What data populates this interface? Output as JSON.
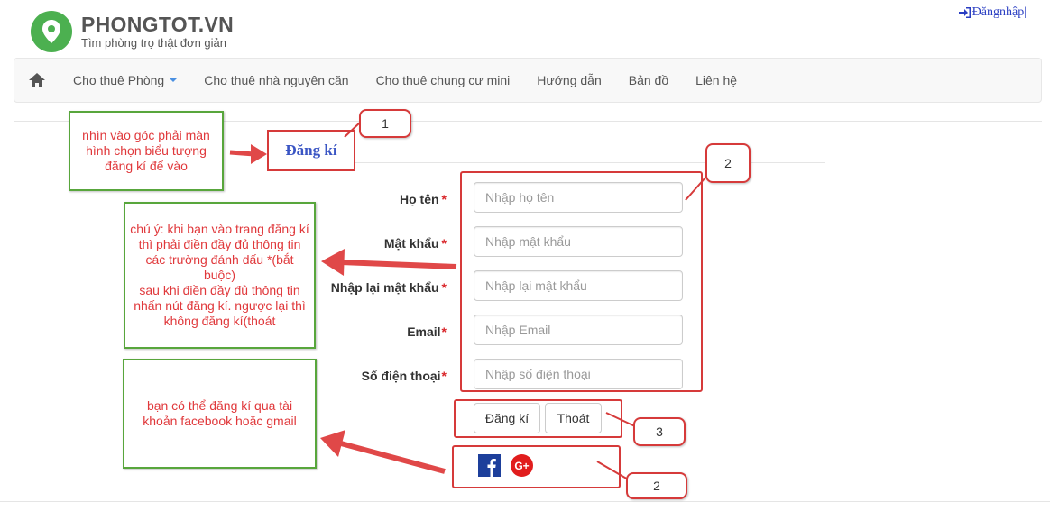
{
  "header": {
    "logo_title": "PHONGTOT.VN",
    "logo_subtitle": "Tìm phòng trọ thật đơn giản",
    "login_label": "Đăngnhập|"
  },
  "nav": {
    "items": [
      {
        "label": "Cho thuê Phòng"
      },
      {
        "label": "Cho thuê nhà nguyên căn"
      },
      {
        "label": "Cho thuê chung cư mini"
      },
      {
        "label": "Hướng dẫn"
      },
      {
        "label": "Bản đồ"
      },
      {
        "label": "Liên hệ"
      }
    ]
  },
  "form": {
    "title": "Đăng kí",
    "required_mark": "*",
    "fields": [
      {
        "label": "Họ tên",
        "placeholder": "Nhập họ tên"
      },
      {
        "label": "Mật khẩu",
        "placeholder": "Nhập mật khẩu"
      },
      {
        "label": "Nhập lại mật khẩu",
        "placeholder": "Nhập lại mật khẩu"
      },
      {
        "label": "Email",
        "placeholder": "Nhập Email"
      },
      {
        "label": "Số điện thoại",
        "placeholder": "Nhập số điện thoại"
      }
    ],
    "submit_label": "Đăng kí",
    "exit_label": "Thoát",
    "social": {
      "facebook_glyph": "f",
      "google_glyph": "G+"
    }
  },
  "annotations": {
    "note_top": "nhìn vào góc phải màn hình chọn biểu tượng đăng kí để vào",
    "note_middle": "chú ý: khi bạn vào trang đăng kí thì phải điền đầy đủ thông tin các trường đánh dấu *(bắt buộc)\nsau khi điền đầy đủ thông tin nhấn nút đăng kí. ngược lại thì không đăng kí(thoát",
    "note_bottom": "bạn có thể đăng kí qua tài khoản facebook hoặc gmail",
    "num_1": "1",
    "num_2_form": "2",
    "num_3": "3",
    "num_2_social": "2"
  },
  "colors": {
    "annotation_red": "#d63a3a",
    "note_green": "#58a63c",
    "brand_green": "#4cb050"
  }
}
